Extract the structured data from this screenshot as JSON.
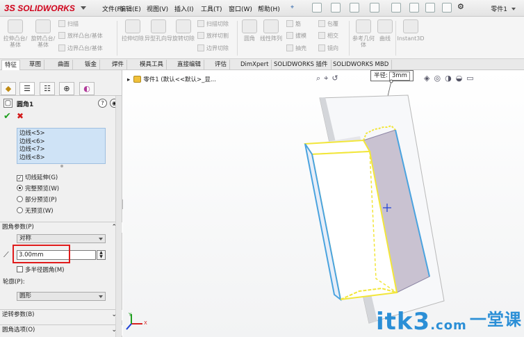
{
  "app": {
    "logo": "SOLIDWORKS",
    "logo_prefix": "3S",
    "document_title": "零件1"
  },
  "menu": [
    "文件(F)",
    "编辑(E)",
    "视图(V)",
    "插入(I)",
    "工具(T)",
    "窗口(W)",
    "帮助(H)"
  ],
  "ribbon": {
    "big": [
      "拉伸凸台/基体",
      "旋转凸台/基体",
      "拉伸切除",
      "异型孔向导",
      "旋转切除",
      "圆角",
      "线性阵列",
      "参考几何体",
      "曲线",
      "Instant3D"
    ],
    "small": [
      "扫描",
      "放样凸台/基体",
      "边界凸台/基体",
      "扫描切除",
      "放样切割",
      "边界切除",
      "筋",
      "拔模",
      "抽壳",
      "包覆",
      "相交",
      "镜向"
    ]
  },
  "tabs": [
    "特征",
    "草图",
    "曲面",
    "钣金",
    "焊件",
    "模具工具",
    "直接编辑",
    "评估",
    "DimXpert",
    "SOLIDWORKS 插件",
    "SOLIDWORKS MBD"
  ],
  "panel": {
    "feature_title": "圆角1",
    "help": "?",
    "edges": [
      "边线<5>",
      "边线<6>",
      "边线<7>",
      "边线<8>"
    ],
    "tangent_propagation": "切线延伸(G)",
    "preview_full": "完整预览(W)",
    "preview_partial": "部分预览(P)",
    "preview_none": "无预览(W)",
    "fillet_params_header": "圆角参数(P)",
    "symmetry": "对称",
    "radius_value": "3.00mm",
    "multi_radius": "多半径圆角(M)",
    "profile_label": "轮廓(P):",
    "profile_value": "圆形",
    "setback_header": "逆转参数(B)",
    "options_header": "圆角选项(O)"
  },
  "view": {
    "tree_item": "零件1 (默认<<默认>_显...",
    "callout_label": "半径:",
    "callout_value": "3mm",
    "axis_x": "X",
    "axis_y": "Y"
  },
  "watermark": {
    "brand": "itk3",
    "suffix": ".com",
    "cn": "一堂课"
  }
}
